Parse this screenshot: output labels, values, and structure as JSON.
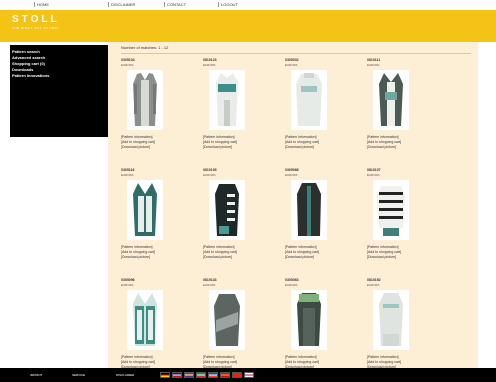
{
  "topnav": {
    "items": [
      "HOME",
      "DISCLAIMER",
      "CONTACT",
      "LOGOUT"
    ]
  },
  "brand": {
    "logo": "STOLL",
    "tagline": "THE RIGHT WAY TO KNIT"
  },
  "sidebar": {
    "items": [
      "Pattern search",
      "Advanced search",
      "Shopping cart (0)",
      "Downloads",
      "Pattern Innovations"
    ]
  },
  "results": {
    "matches_label": "Number of matches: 1 - 12"
  },
  "cards": [
    {
      "id": "0305104",
      "region": "EUROPA",
      "links": [
        "[Pattern information]",
        "[Add to shopping cart]",
        "[Download picture]"
      ]
    },
    {
      "id": "0810123",
      "region": "EUROPA",
      "links": [
        "[Pattern information]",
        "[Add to shopping cart]",
        "[Download picture]"
      ]
    },
    {
      "id": "0305032",
      "region": "EUROPA",
      "links": [
        "[Pattern information]",
        "[Add to shopping cart]",
        "[Download picture]"
      ]
    },
    {
      "id": "0810111",
      "region": "EUROPA",
      "links": [
        "[Pattern information]",
        "[Add to shopping cart]",
        "[Download picture]"
      ]
    },
    {
      "id": "0305116",
      "region": "EUROPA",
      "links": [
        "[Pattern information]",
        "[Add to shopping cart]",
        "[Download picture]"
      ]
    },
    {
      "id": "0810105",
      "region": "EUROPA",
      "links": [
        "[Pattern information]",
        "[Add to shopping cart]",
        "[Download picture]"
      ]
    },
    {
      "id": "0305068",
      "region": "EUROPA",
      "links": [
        "[Pattern information]",
        "[Add to shopping cart]",
        "[Download picture]"
      ]
    },
    {
      "id": "0810107",
      "region": "EUROPA",
      "links": [
        "[Pattern information]",
        "[Add to shopping cart]",
        "[Download picture]"
      ]
    },
    {
      "id": "0305096",
      "region": "EUROPA",
      "links": [
        "[Pattern information]",
        "[Add to shopping cart]",
        "[Download picture]"
      ]
    },
    {
      "id": "0810133",
      "region": "EUROPA",
      "links": [
        "[Pattern information]",
        "[Add to shopping cart]",
        "[Download picture]"
      ]
    },
    {
      "id": "0305063",
      "region": "EUROPA",
      "links": [
        "[Pattern information]",
        "[Add to shopping cart]",
        "[Download picture]"
      ]
    },
    {
      "id": "0810152",
      "region": "EUROPA",
      "links": [
        "[Pattern information]",
        "[Add to shopping cart]",
        "[Download picture]"
      ]
    }
  ],
  "footer": {
    "items": [
      "IMPRINT",
      "SERVICE",
      "DISCLAIMER"
    ]
  },
  "flags": [
    {
      "name": "german-flag-icon",
      "colors": [
        "#000000",
        "#dd0000",
        "#ffce00"
      ]
    },
    {
      "name": "uk-flag-icon",
      "colors": [
        "#012169",
        "#ffffff",
        "#c8102e"
      ]
    },
    {
      "name": "us-flag-icon",
      "colors": [
        "#b22234",
        "#ffffff",
        "#3c3b6e"
      ]
    },
    {
      "name": "italian-flag-icon",
      "colors": [
        "#009246",
        "#ffffff",
        "#ce2b37"
      ]
    },
    {
      "name": "french-flag-icon",
      "colors": [
        "#0055a4",
        "#ffffff",
        "#ef4135"
      ]
    },
    {
      "name": "spanish-flag-icon",
      "colors": [
        "#c60b1e",
        "#ffc400",
        "#c60b1e"
      ]
    },
    {
      "name": "chinese-flag-icon",
      "colors": [
        "#de2910",
        "#de2910",
        "#de2910"
      ]
    },
    {
      "name": "japanese-flag-icon",
      "colors": [
        "#ffffff",
        "#bc002d",
        "#ffffff"
      ]
    }
  ],
  "colors": {
    "brand_yellow": "#f3c315",
    "content_bg": "#fdeed6",
    "sidebar_bg": "#000000"
  }
}
